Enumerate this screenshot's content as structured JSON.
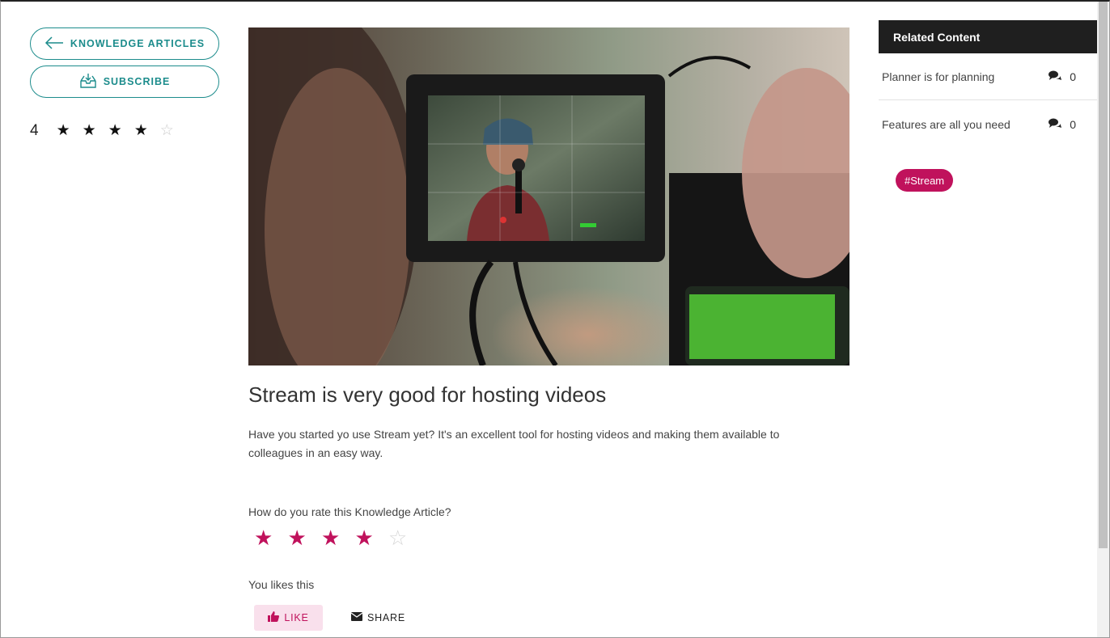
{
  "nav": {
    "back_label": "KNOWLEDGE ARTICLES",
    "subscribe_label": "SUBSCRIBE"
  },
  "rating_summary": {
    "value": "4",
    "stars_filled": 4,
    "stars_total": 5
  },
  "article": {
    "title": "Stream is very good for hosting videos",
    "body": "Have you started yo use Stream yet? It's an excellent tool for hosting videos and making them available to colleagues in an easy way.",
    "rate_question": "How do you rate this Knowledge Article?",
    "user_rating": 4,
    "likes_text": "You likes this",
    "like_label": "LIKE",
    "share_label": "SHARE"
  },
  "related": {
    "header": "Related Content",
    "items": [
      {
        "title": "Planner is for planning",
        "comments": "0"
      },
      {
        "title": "Features are all you need",
        "comments": "0"
      }
    ],
    "tag": "#Stream"
  },
  "colors": {
    "accent_teal": "#1c8c8c",
    "accent_magenta": "#c0125c",
    "header_dark": "#1f1f1f"
  },
  "icons": {
    "back": "arrow-left-icon",
    "subscribe": "inbox-download-icon",
    "comments": "comments-icon",
    "like": "thumbs-up-icon",
    "share": "envelope-icon"
  }
}
